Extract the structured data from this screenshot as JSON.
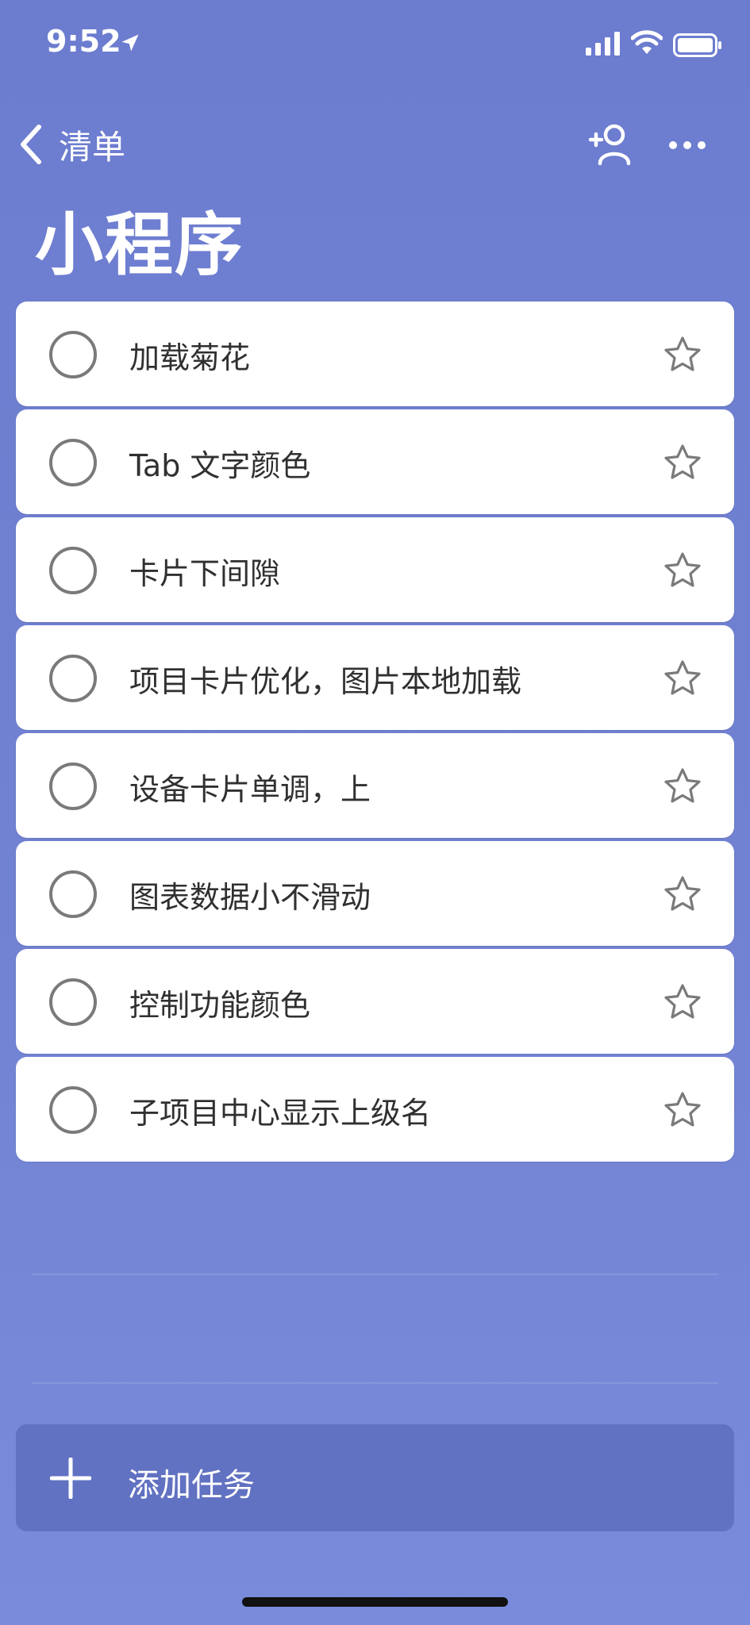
{
  "status_bar": {
    "time": "9:52",
    "icons": [
      "location-arrow-icon",
      "signal-icon",
      "wifi-icon",
      "battery-icon"
    ]
  },
  "nav": {
    "back_label": "清单",
    "icons": [
      "chevron-left-icon",
      "add-person-icon",
      "more-icon"
    ]
  },
  "title": "小程序",
  "tasks": [
    {
      "title": "加载菊花",
      "completed": false,
      "starred": false
    },
    {
      "title": "Tab 文字颜色",
      "completed": false,
      "starred": false
    },
    {
      "title": "卡片下间隙",
      "completed": false,
      "starred": false
    },
    {
      "title": "项目卡片优化，图片本地加载",
      "completed": false,
      "starred": false
    },
    {
      "title": "设备卡片单调，上",
      "completed": false,
      "starred": false
    },
    {
      "title": "图表数据小不滑动",
      "completed": false,
      "starred": false
    },
    {
      "title": "控制功能颜色",
      "completed": false,
      "starred": false
    },
    {
      "title": "子项目中心显示上级名",
      "completed": false,
      "starred": false
    }
  ],
  "add_task": {
    "label": "添加任务",
    "icon": "plus-icon"
  },
  "colors": {
    "background": "#6c7ccf",
    "card": "#ffffff",
    "task_text": "#303030",
    "icon_gray": "#7a7a7a"
  }
}
